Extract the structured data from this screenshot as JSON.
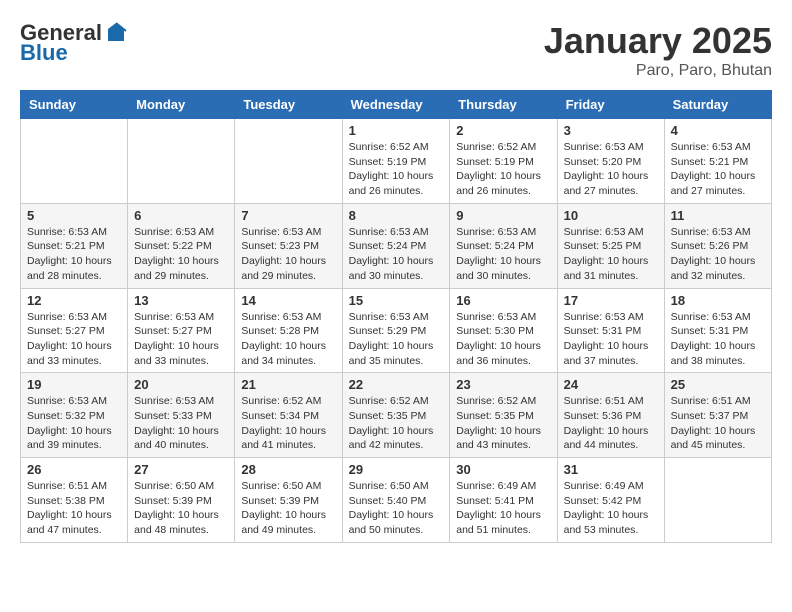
{
  "logo": {
    "general": "General",
    "blue": "Blue"
  },
  "title": "January 2025",
  "subtitle": "Paro, Paro, Bhutan",
  "days_of_week": [
    "Sunday",
    "Monday",
    "Tuesday",
    "Wednesday",
    "Thursday",
    "Friday",
    "Saturday"
  ],
  "weeks": [
    [
      {
        "day": "",
        "info": ""
      },
      {
        "day": "",
        "info": ""
      },
      {
        "day": "",
        "info": ""
      },
      {
        "day": "1",
        "info": "Sunrise: 6:52 AM\nSunset: 5:19 PM\nDaylight: 10 hours\nand 26 minutes."
      },
      {
        "day": "2",
        "info": "Sunrise: 6:52 AM\nSunset: 5:19 PM\nDaylight: 10 hours\nand 26 minutes."
      },
      {
        "day": "3",
        "info": "Sunrise: 6:53 AM\nSunset: 5:20 PM\nDaylight: 10 hours\nand 27 minutes."
      },
      {
        "day": "4",
        "info": "Sunrise: 6:53 AM\nSunset: 5:21 PM\nDaylight: 10 hours\nand 27 minutes."
      }
    ],
    [
      {
        "day": "5",
        "info": "Sunrise: 6:53 AM\nSunset: 5:21 PM\nDaylight: 10 hours\nand 28 minutes."
      },
      {
        "day": "6",
        "info": "Sunrise: 6:53 AM\nSunset: 5:22 PM\nDaylight: 10 hours\nand 29 minutes."
      },
      {
        "day": "7",
        "info": "Sunrise: 6:53 AM\nSunset: 5:23 PM\nDaylight: 10 hours\nand 29 minutes."
      },
      {
        "day": "8",
        "info": "Sunrise: 6:53 AM\nSunset: 5:24 PM\nDaylight: 10 hours\nand 30 minutes."
      },
      {
        "day": "9",
        "info": "Sunrise: 6:53 AM\nSunset: 5:24 PM\nDaylight: 10 hours\nand 30 minutes."
      },
      {
        "day": "10",
        "info": "Sunrise: 6:53 AM\nSunset: 5:25 PM\nDaylight: 10 hours\nand 31 minutes."
      },
      {
        "day": "11",
        "info": "Sunrise: 6:53 AM\nSunset: 5:26 PM\nDaylight: 10 hours\nand 32 minutes."
      }
    ],
    [
      {
        "day": "12",
        "info": "Sunrise: 6:53 AM\nSunset: 5:27 PM\nDaylight: 10 hours\nand 33 minutes."
      },
      {
        "day": "13",
        "info": "Sunrise: 6:53 AM\nSunset: 5:27 PM\nDaylight: 10 hours\nand 33 minutes."
      },
      {
        "day": "14",
        "info": "Sunrise: 6:53 AM\nSunset: 5:28 PM\nDaylight: 10 hours\nand 34 minutes."
      },
      {
        "day": "15",
        "info": "Sunrise: 6:53 AM\nSunset: 5:29 PM\nDaylight: 10 hours\nand 35 minutes."
      },
      {
        "day": "16",
        "info": "Sunrise: 6:53 AM\nSunset: 5:30 PM\nDaylight: 10 hours\nand 36 minutes."
      },
      {
        "day": "17",
        "info": "Sunrise: 6:53 AM\nSunset: 5:31 PM\nDaylight: 10 hours\nand 37 minutes."
      },
      {
        "day": "18",
        "info": "Sunrise: 6:53 AM\nSunset: 5:31 PM\nDaylight: 10 hours\nand 38 minutes."
      }
    ],
    [
      {
        "day": "19",
        "info": "Sunrise: 6:53 AM\nSunset: 5:32 PM\nDaylight: 10 hours\nand 39 minutes."
      },
      {
        "day": "20",
        "info": "Sunrise: 6:53 AM\nSunset: 5:33 PM\nDaylight: 10 hours\nand 40 minutes."
      },
      {
        "day": "21",
        "info": "Sunrise: 6:52 AM\nSunset: 5:34 PM\nDaylight: 10 hours\nand 41 minutes."
      },
      {
        "day": "22",
        "info": "Sunrise: 6:52 AM\nSunset: 5:35 PM\nDaylight: 10 hours\nand 42 minutes."
      },
      {
        "day": "23",
        "info": "Sunrise: 6:52 AM\nSunset: 5:35 PM\nDaylight: 10 hours\nand 43 minutes."
      },
      {
        "day": "24",
        "info": "Sunrise: 6:51 AM\nSunset: 5:36 PM\nDaylight: 10 hours\nand 44 minutes."
      },
      {
        "day": "25",
        "info": "Sunrise: 6:51 AM\nSunset: 5:37 PM\nDaylight: 10 hours\nand 45 minutes."
      }
    ],
    [
      {
        "day": "26",
        "info": "Sunrise: 6:51 AM\nSunset: 5:38 PM\nDaylight: 10 hours\nand 47 minutes."
      },
      {
        "day": "27",
        "info": "Sunrise: 6:50 AM\nSunset: 5:39 PM\nDaylight: 10 hours\nand 48 minutes."
      },
      {
        "day": "28",
        "info": "Sunrise: 6:50 AM\nSunset: 5:39 PM\nDaylight: 10 hours\nand 49 minutes."
      },
      {
        "day": "29",
        "info": "Sunrise: 6:50 AM\nSunset: 5:40 PM\nDaylight: 10 hours\nand 50 minutes."
      },
      {
        "day": "30",
        "info": "Sunrise: 6:49 AM\nSunset: 5:41 PM\nDaylight: 10 hours\nand 51 minutes."
      },
      {
        "day": "31",
        "info": "Sunrise: 6:49 AM\nSunset: 5:42 PM\nDaylight: 10 hours\nand 53 minutes."
      },
      {
        "day": "",
        "info": ""
      }
    ]
  ]
}
